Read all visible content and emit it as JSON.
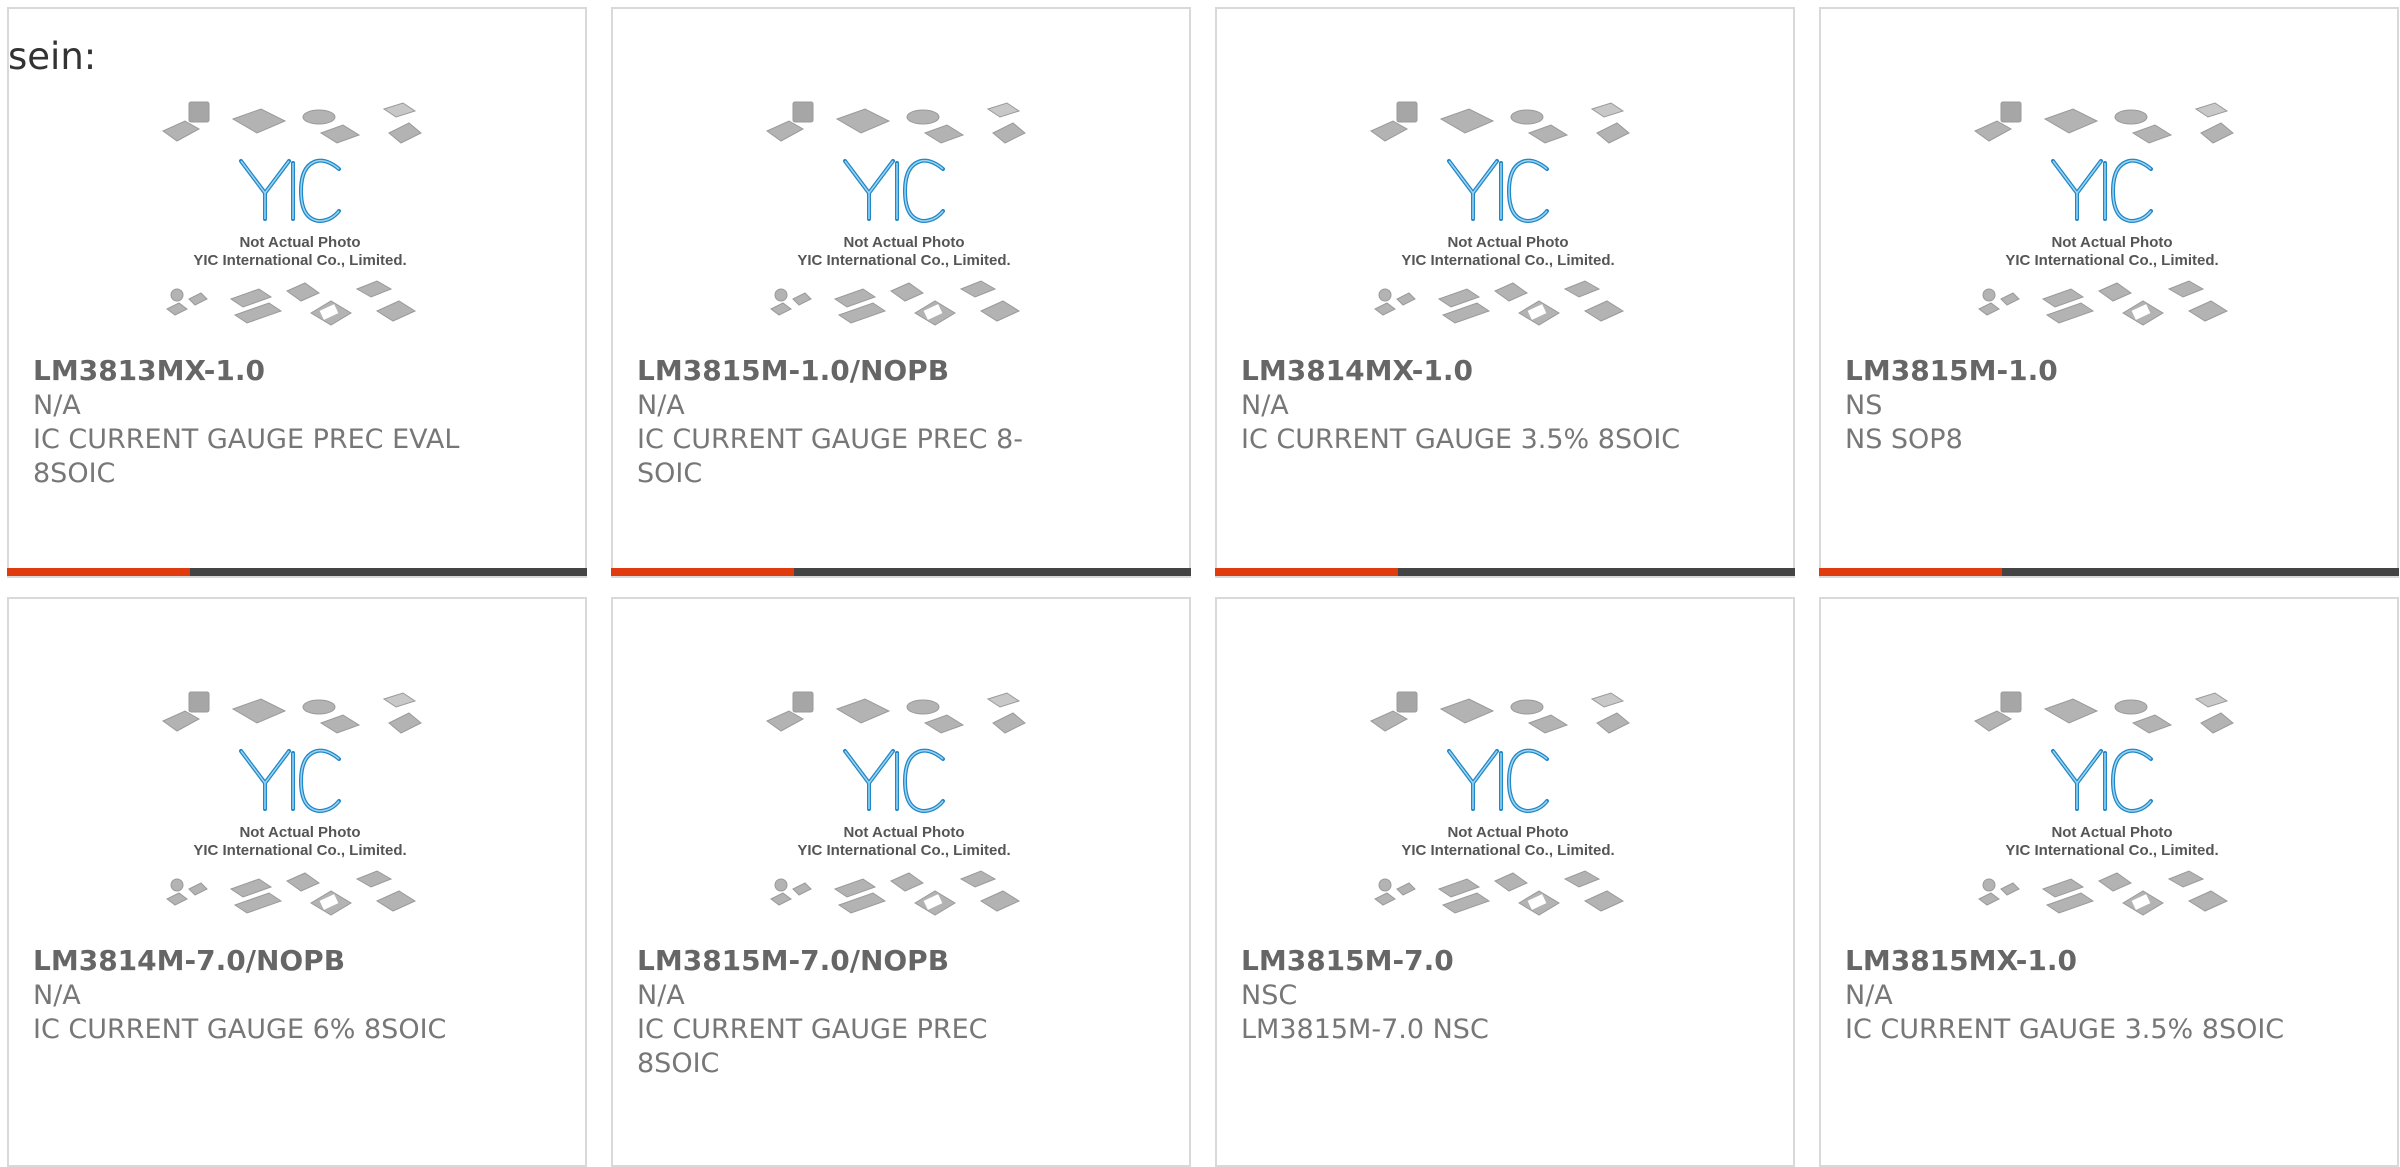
{
  "intro_text": "sein:",
  "colors": {
    "accent": "#e03a0f",
    "bar": "#444444",
    "logo": "#1e88c8"
  },
  "placeholder": {
    "logo_text": "YIC",
    "line1": "Not Actual Photo",
    "line2": "YIC International Co., Limited."
  },
  "products": [
    {
      "part": "LM3813MX-1.0",
      "manufacturer": "N/A",
      "description": "IC CURRENT GAUGE PREC EVAL 8SOIC",
      "has_bar": true
    },
    {
      "part": "LM3815M-1.0/NOPB",
      "manufacturer": "N/A",
      "description": "IC CURRENT GAUGE PREC 8-SOIC",
      "has_bar": true
    },
    {
      "part": "LM3814MX-1.0",
      "manufacturer": "N/A",
      "description": "IC CURRENT GAUGE 3.5% 8SOIC",
      "has_bar": true
    },
    {
      "part": "LM3815M-1.0",
      "manufacturer": "NS",
      "description": "NS SOP8",
      "has_bar": true
    },
    {
      "part": "LM3814M-7.0/NOPB",
      "manufacturer": "N/A",
      "description": "IC CURRENT GAUGE 6% 8SOIC",
      "has_bar": false
    },
    {
      "part": "LM3815M-7.0/NOPB",
      "manufacturer": "N/A",
      "description": "IC CURRENT GAUGE PREC 8SOIC",
      "has_bar": false
    },
    {
      "part": "LM3815M-7.0",
      "manufacturer": "NSC",
      "description": "LM3815M-7.0 NSC",
      "has_bar": false
    },
    {
      "part": "LM3815MX-1.0",
      "manufacturer": "N/A",
      "description": "IC CURRENT GAUGE 3.5% 8SOIC",
      "has_bar": false
    }
  ]
}
